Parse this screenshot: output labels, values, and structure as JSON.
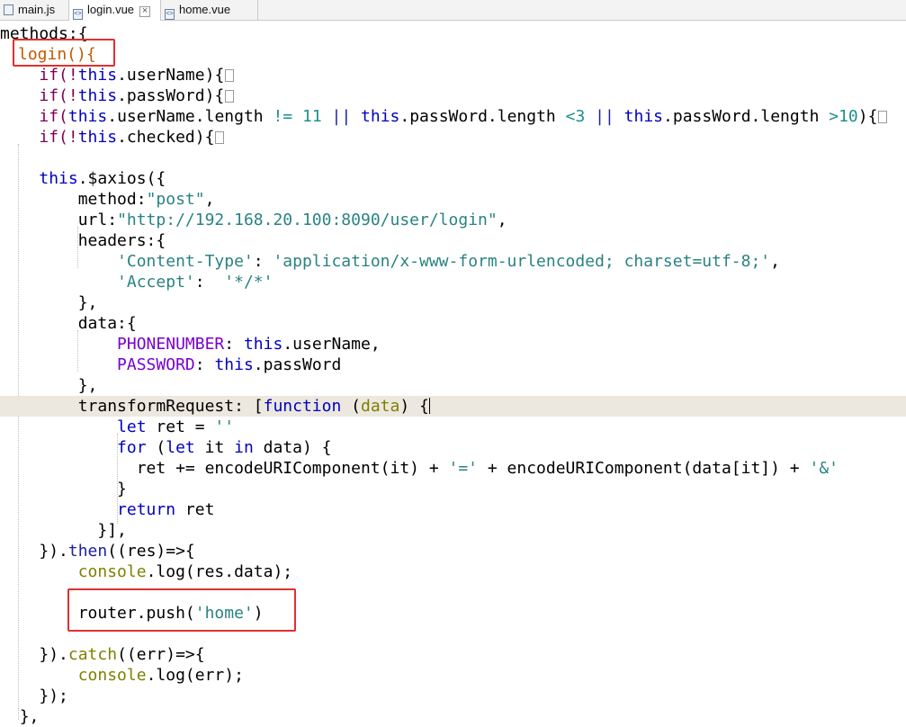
{
  "tabs": [
    {
      "label": "main.js",
      "active": false
    },
    {
      "label": "login.vue",
      "active": true
    },
    {
      "label": "home.vue",
      "active": false
    }
  ],
  "colors": {
    "highlight_box": "#e03030",
    "current_line": "#ece8df",
    "keyword": "#7f0055",
    "string": "#2a8282"
  },
  "icons": [
    "vue-file-icon",
    "close-tab-icon",
    "fold-marker-icon"
  ],
  "code": {
    "l1": "methods:{",
    "l2": "login(){",
    "l3a": "if(!",
    "l3b": "this",
    "l3c": ".userName){",
    "l4a": "if(!",
    "l4b": "this",
    "l4c": ".passWord){",
    "l5a": "if(",
    "l5b": "this",
    "l5c": ".userName.length ",
    "l5d": "!= 11",
    "l5e": " || ",
    "l5f": "this",
    "l5g": ".passWord.length ",
    "l5h": "<3",
    "l5i": " || ",
    "l5j": "this",
    "l5k": ".passWord.length ",
    "l5l": ">10",
    "l5m": "){",
    "l6a": "if(!",
    "l6b": "this",
    "l6c": ".checked){",
    "l8a": "this",
    "l8b": ".$axios({",
    "l9a": "method:",
    "l9b": "\"post\"",
    "l9c": ",",
    "l10a": "url:",
    "l10b": "\"http://192.168.20.100:8090/user/login\"",
    "l10c": ",",
    "l11": "headers:{",
    "l12a": "'Content-Type'",
    "l12b": ": ",
    "l12c": "'application/x-www-form-urlencoded; charset=utf-8;'",
    "l12d": ",",
    "l13a": "'Accept'",
    "l13b": ":  ",
    "l13c": "'*/*'",
    "l14": "},",
    "l15": "data:{",
    "l16a": "PHONENUMBER",
    "l16b": ": ",
    "l16c": "this",
    "l16d": ".userName,",
    "l17a": "PASSWORD",
    "l17b": ": ",
    "l17c": "this",
    "l17d": ".passWord",
    "l18": "},",
    "l19a": "transformRequest",
    "l19b": ": [",
    "l19c": "function",
    "l19d": " (",
    "l19e": "data",
    "l19f": ") {",
    "l20a": "let",
    "l20b": " ret = ",
    "l20c": "''",
    "l21a": "for",
    "l21b": " (",
    "l21c": "let",
    "l21d": " it ",
    "l21e": "in",
    "l21f": " data) {",
    "l22a": "ret += encodeURIComponent(it) + ",
    "l22b": "'='",
    "l22c": " + encodeURIComponent(data[it]) + ",
    "l22d": "'&'",
    "l23": "}",
    "l24a": "return",
    "l24b": " ret",
    "l25": "}],",
    "l26a": "}).",
    "l26b": "then",
    "l26c": "((res)=>{",
    "l27a": "console",
    "l27b": ".log(res.data);",
    "l29a": "router.push(",
    "l29b": "'home'",
    "l29c": ")",
    "l31a": "}).",
    "l31b": "catch",
    "l31c": "((err)=>{",
    "l32a": "console",
    "l32b": ".log(err);",
    "l33": "});",
    "l34": "},"
  }
}
